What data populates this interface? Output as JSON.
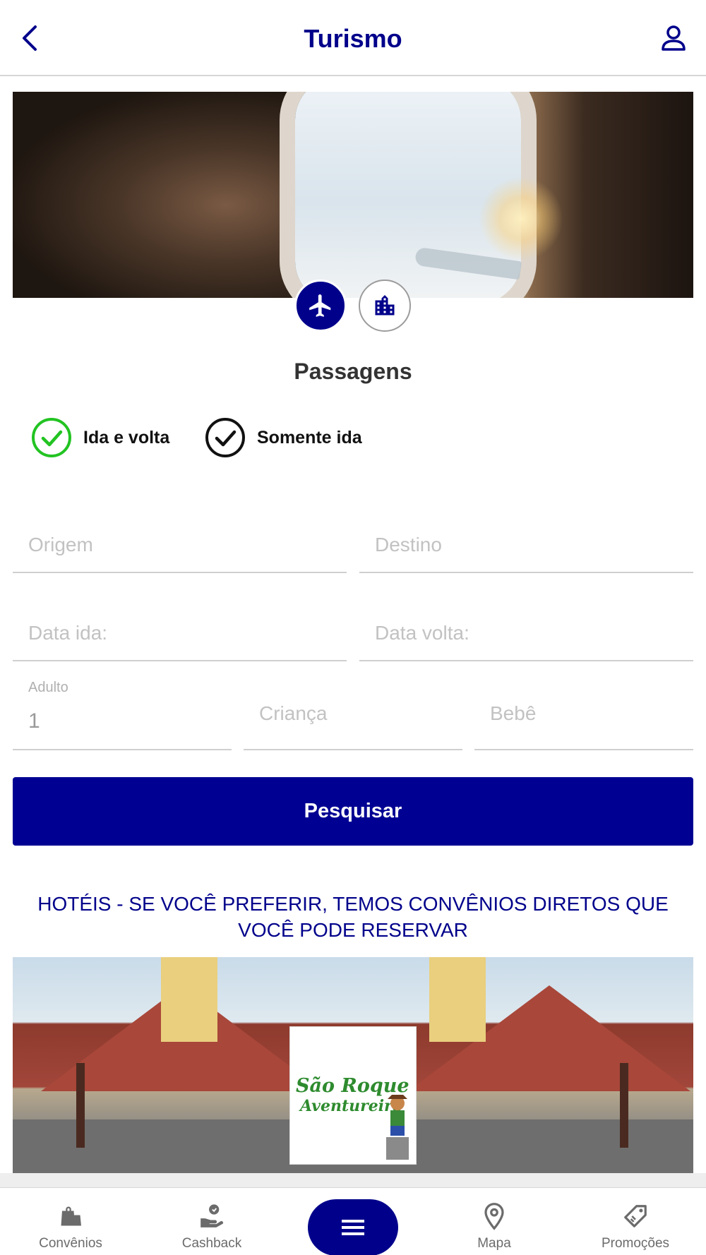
{
  "header": {
    "title": "Turismo",
    "back_icon": "chevron-left-icon",
    "profile_icon": "user-icon"
  },
  "modes": [
    {
      "name": "flight",
      "icon": "airplane-icon",
      "selected": true
    },
    {
      "name": "hotel",
      "icon": "building-icon",
      "selected": false
    }
  ],
  "section_title": "Passagens",
  "trip_type": {
    "options": [
      {
        "label": "Ida e volta",
        "selected": true
      },
      {
        "label": "Somente ida",
        "selected": false
      }
    ]
  },
  "form": {
    "origem_placeholder": "Origem",
    "destino_placeholder": "Destino",
    "data_ida_placeholder": "Data ida:",
    "data_volta_placeholder": "Data volta:",
    "adulto_label": "Adulto",
    "adulto_value": "1",
    "crianca_placeholder": "Criança",
    "bebe_placeholder": "Bebê"
  },
  "search_button": "Pesquisar",
  "promo": {
    "text": "HOTÉIS - SE VOCÊ PREFERIR, TEMOS CONVÊNIOS DIRETOS QUE VOCÊ PODE RESERVAR",
    "logo_line1": "São Roque",
    "logo_line2": "Aventureiro"
  },
  "bottom_nav": {
    "items": [
      {
        "label": "Convênios",
        "icon": "shopping-bag-icon"
      },
      {
        "label": "Cashback",
        "icon": "hand-coin-icon"
      },
      {
        "label": "",
        "icon": "menu-icon"
      },
      {
        "label": "Mapa",
        "icon": "map-pin-icon"
      },
      {
        "label": "Promoções",
        "icon": "tag-icon"
      }
    ]
  },
  "colors": {
    "primary": "#00008b",
    "button": "#000093",
    "check_selected": "#22c322",
    "placeholder": "#c2c2c2"
  }
}
